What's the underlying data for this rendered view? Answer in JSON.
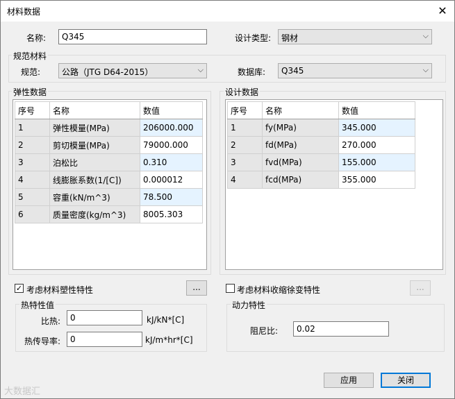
{
  "window": {
    "title": "材料数据",
    "close_icon": "close-icon"
  },
  "name": {
    "label": "名称:",
    "value": "Q345"
  },
  "design_type": {
    "label": "设计类型:",
    "value": "钢材"
  },
  "spec_group": {
    "title": "规范材料",
    "spec_label": "规范:",
    "spec_value": "公路（JTG D64-2015）",
    "db_label": "数据库:",
    "db_value": "Q345"
  },
  "elastic": {
    "title": "弹性数据",
    "headers": [
      "序号",
      "名称",
      "数值"
    ],
    "rows": [
      {
        "idx": "1",
        "name": "弹性模量(MPa)",
        "value": "206000.000"
      },
      {
        "idx": "2",
        "name": "剪切模量(MPa)",
        "value": "79000.000"
      },
      {
        "idx": "3",
        "name": "泊松比",
        "value": "0.310"
      },
      {
        "idx": "4",
        "name": "线膨胀系数(1/[C])",
        "value": "0.000012"
      },
      {
        "idx": "5",
        "name": "容重(kN/m^3)",
        "value": "78.500"
      },
      {
        "idx": "6",
        "name": "质量密度(kg/m^3)",
        "value": "8005.303"
      }
    ]
  },
  "design": {
    "title": "设计数据",
    "headers": [
      "序号",
      "名称",
      "数值"
    ],
    "rows": [
      {
        "idx": "1",
        "name": "fy(MPa)",
        "value": "345.000"
      },
      {
        "idx": "2",
        "name": "fd(MPa)",
        "value": "270.000"
      },
      {
        "idx": "3",
        "name": "fvd(MPa)",
        "value": "155.000"
      },
      {
        "idx": "4",
        "name": "fcd(MPa)",
        "value": "355.000"
      }
    ]
  },
  "plastic": {
    "label": "考虑材料塑性特性",
    "checked": true,
    "button": "..."
  },
  "creep": {
    "label": "考虑材料收缩徐变特性",
    "checked": false,
    "button": "..."
  },
  "thermal": {
    "title": "热特性值",
    "specific_heat_label": "比热:",
    "specific_heat_value": "0",
    "specific_heat_unit": "kJ/kN*[C]",
    "conductivity_label": "热传导率:",
    "conductivity_value": "0",
    "conductivity_unit": "kJ/m*hr*[C]"
  },
  "dynamic": {
    "title": "动力特性",
    "damping_label": "阻尼比:",
    "damping_value": "0.02"
  },
  "buttons": {
    "apply": "应用",
    "close": "关闭"
  },
  "watermark": "大数据汇"
}
